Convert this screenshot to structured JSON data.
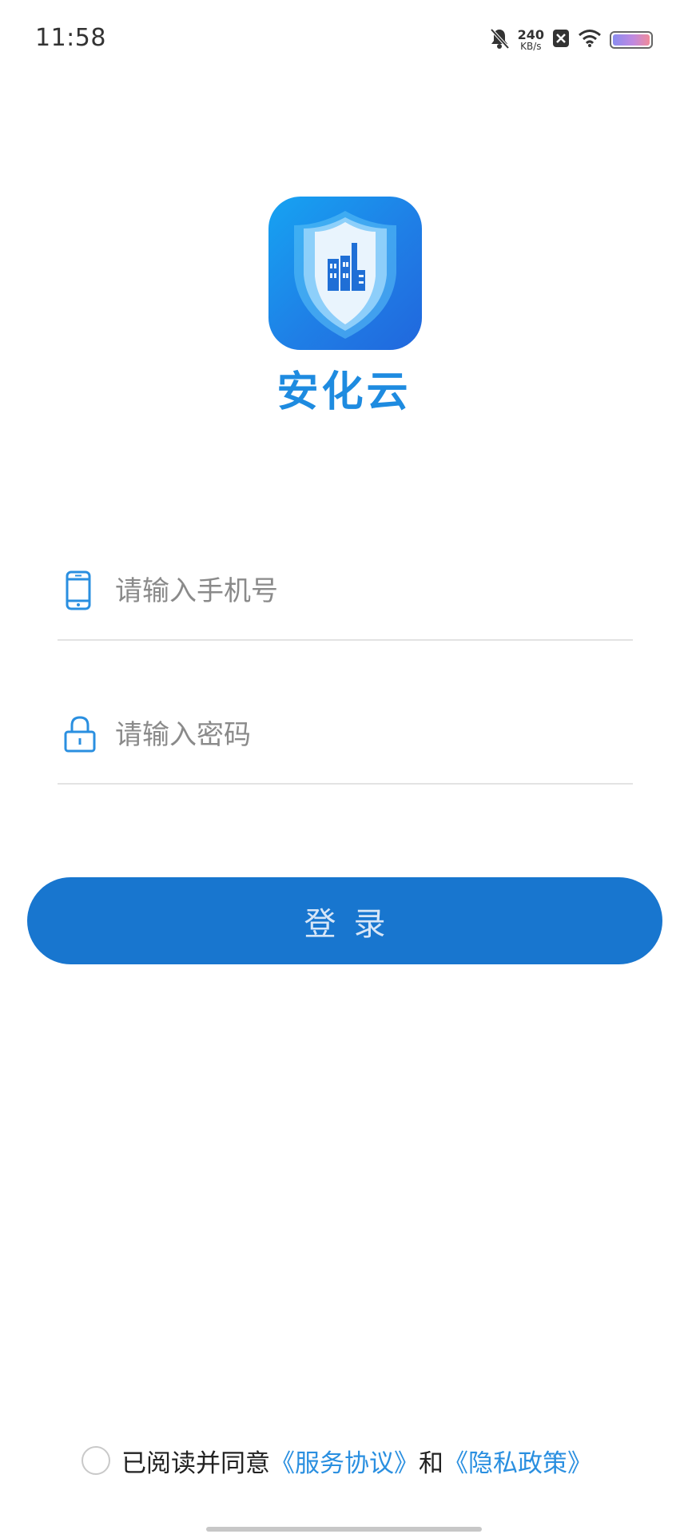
{
  "status_bar": {
    "time": "11:58",
    "net_speed_value": "240",
    "net_speed_unit": "KB/s",
    "icons": [
      "bell-muted-icon",
      "blocked-icon",
      "wifi-icon",
      "battery-icon"
    ]
  },
  "app": {
    "name": "安化云",
    "logo_icon": "shield-factory-logo",
    "brand_color": "#1e8be0"
  },
  "login_form": {
    "phone_placeholder": "请输入手机号",
    "phone_icon": "phone-icon",
    "password_placeholder": "请输入密码",
    "password_icon": "lock-icon",
    "submit_label": "登录",
    "button_color": "#1876cf"
  },
  "agreement": {
    "prefix": "已阅读并同意",
    "service_link": "《服务协议》",
    "connector": "和",
    "privacy_link": "《隐私政策》",
    "checked": false
  }
}
